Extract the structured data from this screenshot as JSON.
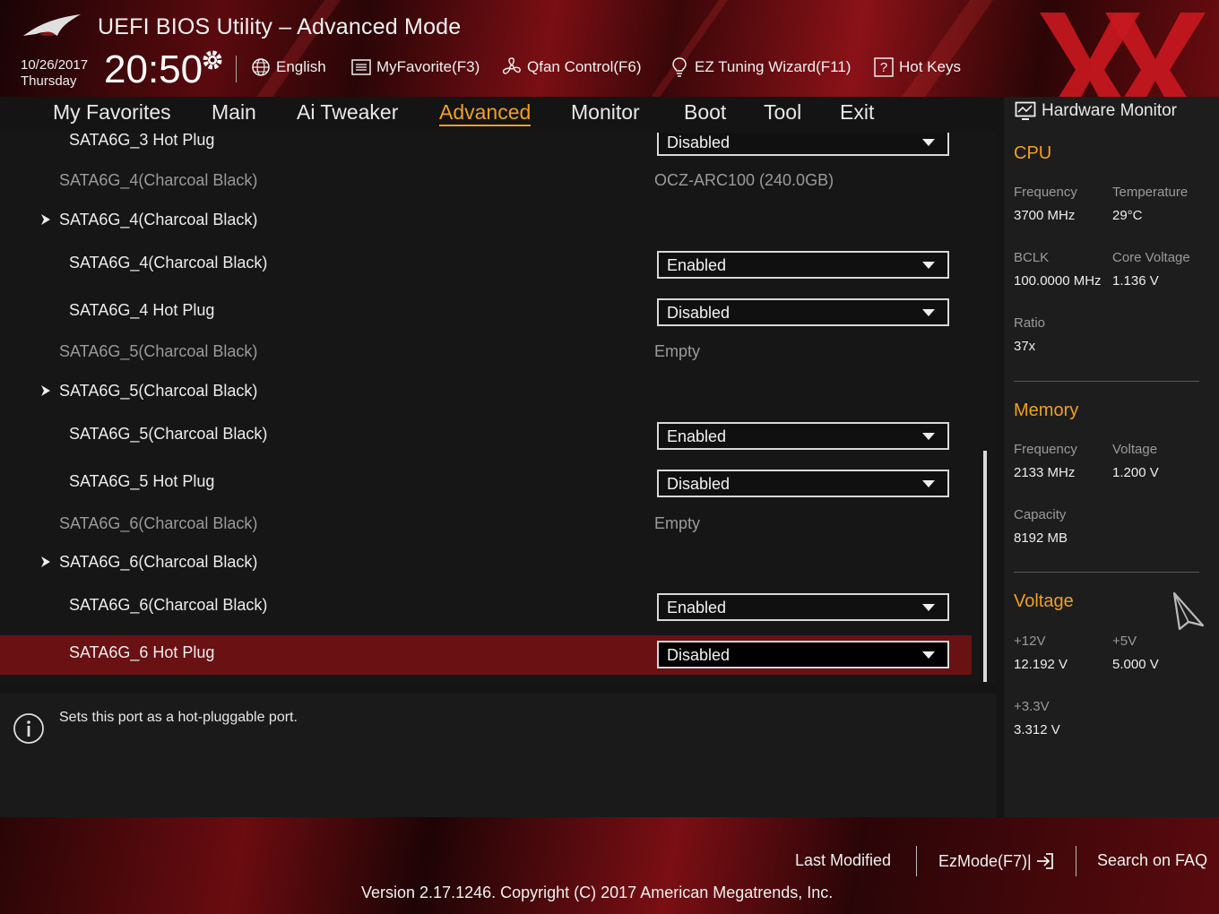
{
  "header": {
    "title": "UEFI BIOS Utility – Advanced Mode",
    "date": "10/26/2017",
    "day": "Thursday",
    "time": "20:50",
    "tools": [
      {
        "label": "English",
        "icon": "globe-icon"
      },
      {
        "label": "MyFavorite(F3)",
        "icon": "favorite-list-icon"
      },
      {
        "label": "Qfan Control(F6)",
        "icon": "fan-icon"
      },
      {
        "label": "EZ Tuning Wizard(F11)",
        "icon": "lightbulb-icon"
      },
      {
        "label": "Hot Keys",
        "icon": "question-icon"
      }
    ],
    "accent_color": "#f0a020",
    "brand_color": "#c81820"
  },
  "nav": {
    "tabs": [
      "My Favorites",
      "Main",
      "Ai Tweaker",
      "Advanced",
      "Monitor",
      "Boot",
      "Tool",
      "Exit"
    ],
    "active": "Advanced"
  },
  "main": {
    "rows": [
      {
        "type": "setting",
        "label": "SATA6G_3 Hot Plug",
        "value": "Disabled"
      },
      {
        "type": "info",
        "label": "SATA6G_4(Charcoal Black)",
        "value": "OCZ-ARC100 (240.0GB)"
      },
      {
        "type": "submenu",
        "label": "SATA6G_4(Charcoal Black)"
      },
      {
        "type": "setting",
        "label": "SATA6G_4(Charcoal Black)",
        "value": "Enabled"
      },
      {
        "type": "setting",
        "label": "SATA6G_4 Hot Plug",
        "value": "Disabled"
      },
      {
        "type": "info",
        "label": "SATA6G_5(Charcoal Black)",
        "value": "Empty"
      },
      {
        "type": "submenu",
        "label": "SATA6G_5(Charcoal Black)"
      },
      {
        "type": "setting",
        "label": "SATA6G_5(Charcoal Black)",
        "value": "Enabled"
      },
      {
        "type": "setting",
        "label": "SATA6G_5 Hot Plug",
        "value": "Disabled"
      },
      {
        "type": "info",
        "label": "SATA6G_6(Charcoal Black)",
        "value": "Empty"
      },
      {
        "type": "submenu",
        "label": "SATA6G_6(Charcoal Black)"
      },
      {
        "type": "setting",
        "label": "SATA6G_6(Charcoal Black)",
        "value": "Enabled"
      },
      {
        "type": "setting",
        "label": "SATA6G_6 Hot Plug",
        "value": "Disabled",
        "selected": true
      }
    ]
  },
  "help": {
    "text": "Sets this port as a hot-pluggable port."
  },
  "hardware_monitor": {
    "title": "Hardware Monitor",
    "cpu": {
      "heading": "CPU",
      "frequency_label": "Frequency",
      "frequency": "3700 MHz",
      "temperature_label": "Temperature",
      "temperature": "29°C",
      "bclk_label": "BCLK",
      "bclk": "100.0000 MHz",
      "core_voltage_label": "Core Voltage",
      "core_voltage": "1.136 V",
      "ratio_label": "Ratio",
      "ratio": "37x"
    },
    "memory": {
      "heading": "Memory",
      "frequency_label": "Frequency",
      "frequency": "2133 MHz",
      "voltage_label": "Voltage",
      "voltage": "1.200 V",
      "capacity_label": "Capacity",
      "capacity": "8192 MB"
    },
    "voltage": {
      "heading": "Voltage",
      "v12_label": "+12V",
      "v12": "12.192 V",
      "v5_label": "+5V",
      "v5": "5.000 V",
      "v33_label": "+3.3V",
      "v33": "3.312 V"
    }
  },
  "footer": {
    "last_modified": "Last Modified",
    "ezmode": "EzMode(F7)|",
    "faq": "Search on FAQ",
    "version": "Version 2.17.1246. Copyright (C) 2017 American Megatrends, Inc."
  }
}
